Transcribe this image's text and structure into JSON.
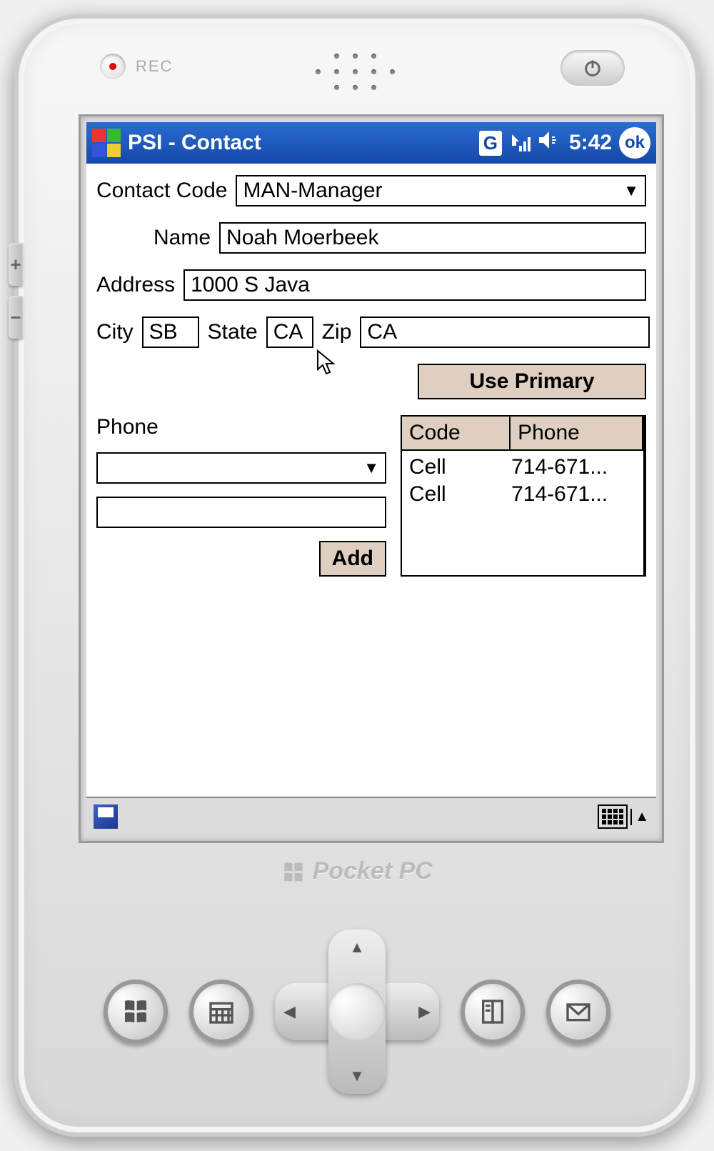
{
  "device": {
    "rec_label": "REC",
    "brand": "Pocket PC"
  },
  "titlebar": {
    "title": "PSI - Contact",
    "g_indicator": "G",
    "time": "5:42",
    "ok_label": "ok"
  },
  "form": {
    "contact_code_label": "Contact Code",
    "contact_code_value": "MAN-Manager",
    "name_label": "Name",
    "name_value": "Noah Moerbeek",
    "address_label": "Address",
    "address_value": "1000 S Java",
    "city_label": "City",
    "city_value": "SB",
    "state_label": "State",
    "state_value": "CA",
    "zip_label": "Zip",
    "zip_value": "CA",
    "use_primary_label": "Use Primary",
    "phone_label": "Phone",
    "phone_type_value": "",
    "phone_number_value": "",
    "add_label": "Add",
    "table": {
      "col_code": "Code",
      "col_phone": "Phone",
      "rows": [
        {
          "code": "Cell",
          "phone": "714-671..."
        },
        {
          "code": "Cell",
          "phone": "714-671..."
        }
      ]
    }
  }
}
